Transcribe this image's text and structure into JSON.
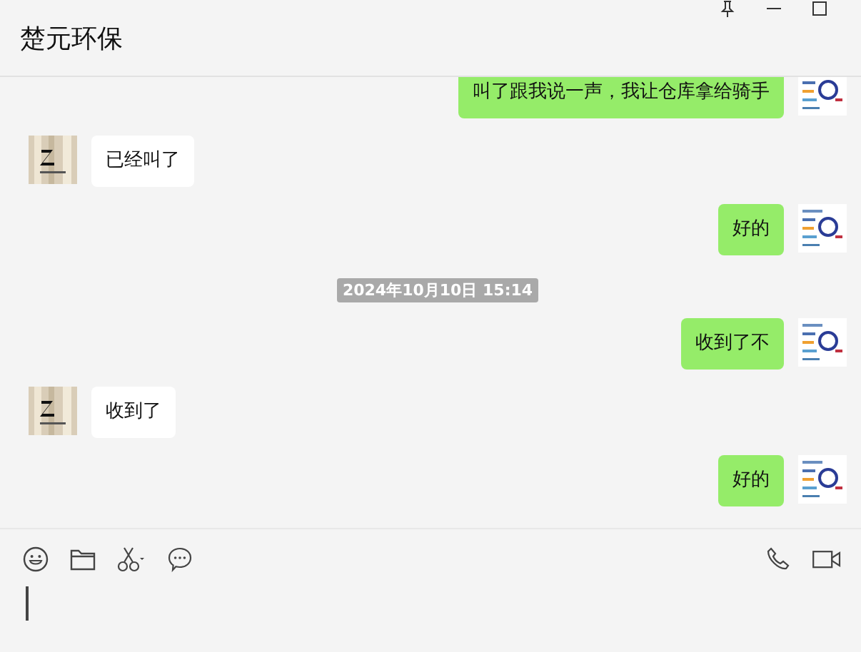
{
  "header": {
    "title": "楚元环保"
  },
  "messages": [
    {
      "kind": "sent",
      "text": "叫了跟我说一声，我让仓库拿给骑手"
    },
    {
      "kind": "received",
      "text": "已经叫了"
    },
    {
      "kind": "sent",
      "text": "好的"
    },
    {
      "kind": "time",
      "text": "2024年10月10日 15:14"
    },
    {
      "kind": "sent",
      "text": "收到了不"
    },
    {
      "kind": "received",
      "text": "收到了"
    },
    {
      "kind": "sent",
      "text": "好的"
    }
  ]
}
